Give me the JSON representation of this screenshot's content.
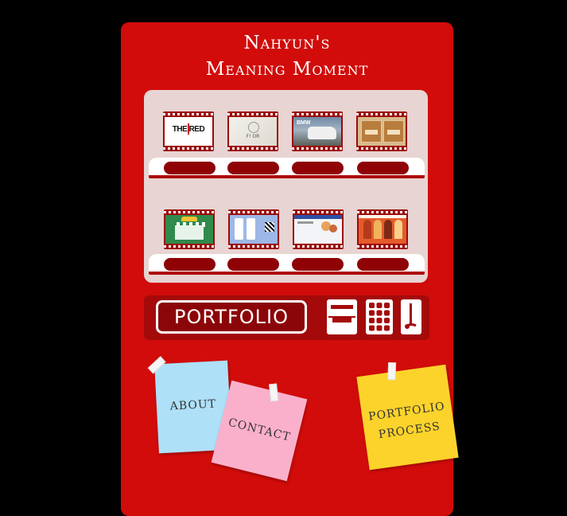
{
  "header": {
    "title_line1": "Nahyun's",
    "title_line2": "Meaning Moment"
  },
  "shelves": [
    {
      "items": [
        {
          "name": "the-red-thumbnail",
          "label": "THE RED"
        },
        {
          "name": "fior-thumbnail",
          "label": "F! OR"
        },
        {
          "name": "bmw-thumbnail",
          "label": "BMW"
        },
        {
          "name": "bakery-box-thumbnail",
          "label": ""
        }
      ]
    },
    {
      "items": [
        {
          "name": "green-shop-thumbnail",
          "label": ""
        },
        {
          "name": "mobile-app-thumbnail",
          "label": ""
        },
        {
          "name": "website-thumbnail",
          "label": ""
        },
        {
          "name": "people-banner-thumbnail",
          "label": ""
        }
      ]
    }
  ],
  "panel": {
    "portfolio_label": "PORTFOLIO",
    "icons": [
      "coin-slot-icon",
      "keypad-icon",
      "lever-icon"
    ]
  },
  "notes": {
    "about": "ABOUT",
    "contact": "CONTACT",
    "process_line1": "PORTFOLIO",
    "process_line2": "PROCESS"
  },
  "colors": {
    "machine": "#d10c0a",
    "display": "#e8d4d2",
    "dark_red": "#8f0306",
    "note_blue": "#aee0f8",
    "note_pink": "#fab0cb",
    "note_yellow": "#fbd32b"
  }
}
